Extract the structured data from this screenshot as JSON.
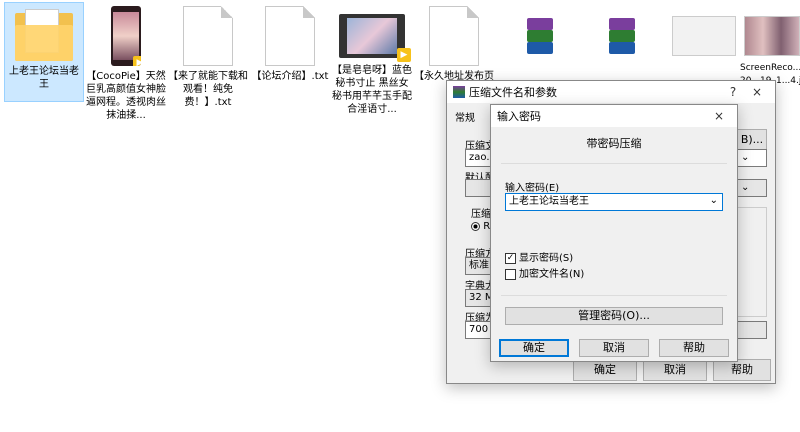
{
  "desktop": {
    "files": [
      {
        "label": "上老王论坛当老王",
        "type": "folder"
      },
      {
        "label": "【CocoPie】天然巨乳高颜值女神脸逼网程。透视肉丝抹油揉...",
        "type": "video-thumb"
      },
      {
        "label": "【来了就能下载和观看！纯免费！】.txt",
        "type": "text"
      },
      {
        "label": "【论坛介绍】.txt",
        "type": "text"
      },
      {
        "label": "【是皂皂呀】蓝色秘书寸止 黑丝女秘书用芊芊玉手配合淫语寸...",
        "type": "video"
      },
      {
        "label": "【永久地址发布页",
        "type": "text"
      },
      {
        "label": "",
        "type": "rar"
      },
      {
        "label": "",
        "type": "rar"
      },
      {
        "label": "",
        "type": "image"
      },
      {
        "label": "ScreenReco...1-20...19_1...4.jpg",
        "type": "image-strip"
      }
    ]
  },
  "back_dialog": {
    "title": "压缩文件名和参数",
    "tab": "常规",
    "labels": {
      "archive": "压缩文",
      "default": "默认配",
      "format": "压缩为",
      "method": "压缩方",
      "dict": "字典大",
      "split": "压缩为"
    },
    "values": {
      "archive_name": "zao.r",
      "method": "标准",
      "dict": "32 MB",
      "split": "700",
      "format_opt": "RA"
    },
    "buttons": {
      "browse": "B)...",
      "ok": "确定",
      "cancel": "取消",
      "help": "帮助"
    },
    "help_icon": "?",
    "close_icon": "×"
  },
  "password_dialog": {
    "title": "输入密码",
    "close_icon": "×",
    "heading": "带密码压缩",
    "password_label": "输入密码(E)",
    "password_value": "上老王论坛当老王",
    "show_password": "显示密码(S)",
    "show_password_checked": true,
    "encrypt_names": "加密文件名(N)",
    "encrypt_names_checked": false,
    "manage_button": "管理密码(O)...",
    "ok": "确定",
    "cancel": "取消",
    "help": "帮助"
  }
}
